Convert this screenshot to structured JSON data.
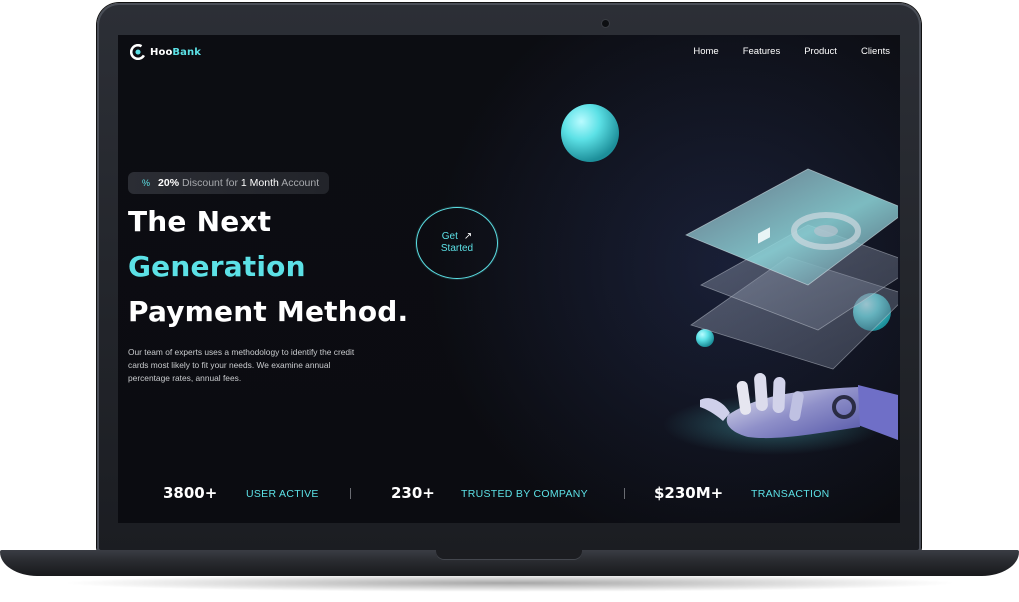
{
  "logo": {
    "prefix": "Hoo",
    "suffix": "Bank"
  },
  "nav": {
    "items": [
      "Home",
      "Features",
      "Product",
      "Clients"
    ]
  },
  "badge": {
    "discount": "20%",
    "text_mid": "Discount for",
    "duration": "1 Month",
    "text_end": "Account"
  },
  "hero": {
    "line1": "The Next",
    "line2": "Generation",
    "line3": "Payment Method.",
    "description": "Our team of experts uses a methodology to identify the credit cards most likely to fit your needs. We examine annual percentage rates, annual fees."
  },
  "cta": {
    "line1": "Get",
    "line2": "Started"
  },
  "stats": [
    {
      "value": "3800+",
      "label": "USER ACTIVE"
    },
    {
      "value": "230+",
      "label": "TRUSTED BY COMPANY"
    },
    {
      "value": "$230M+",
      "label": "TRANSACTION"
    }
  ],
  "colors": {
    "accent": "#5ce1e6",
    "background": "#0c0d12",
    "text": "#ffffff"
  },
  "icons": {
    "logo": "hoobank-logo-icon",
    "badge": "discount-icon",
    "cta": "arrow-up-right-icon"
  }
}
